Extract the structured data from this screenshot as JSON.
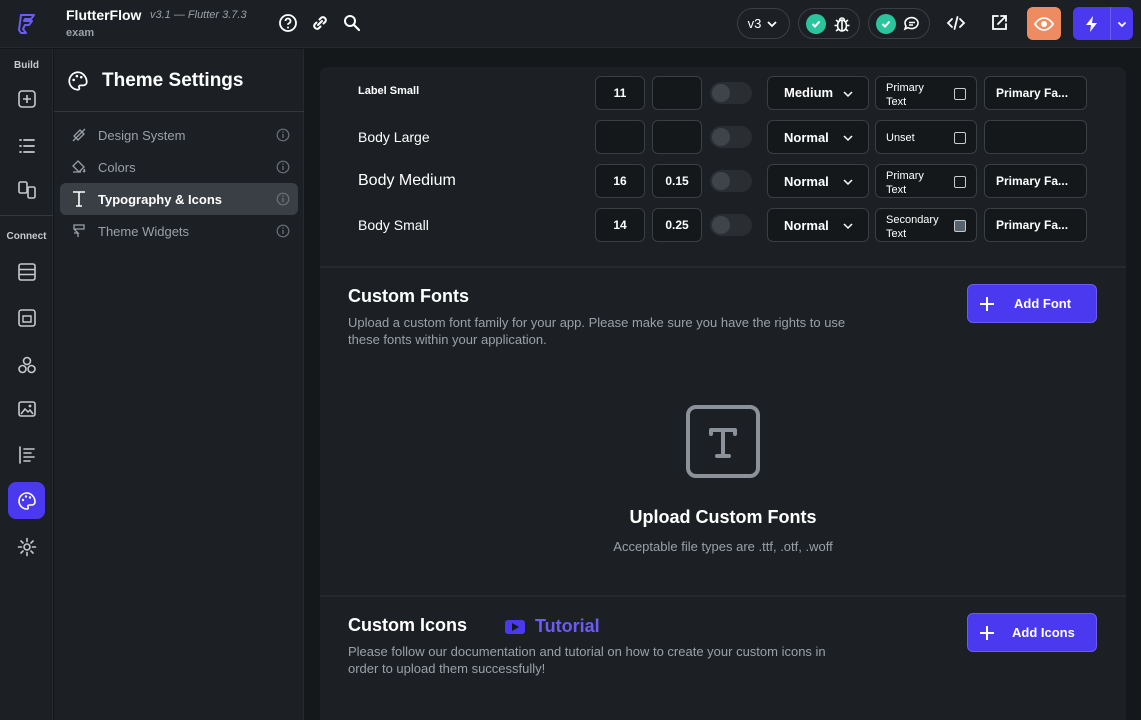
{
  "app": {
    "name": "FlutterFlow",
    "version": "v3.1 — Flutter 3.7.3",
    "project": "exam"
  },
  "topbar": {
    "version_select": "v3"
  },
  "rail": {
    "build_label": "Build",
    "connect_label": "Connect"
  },
  "panel": {
    "title": "Theme Settings",
    "items": [
      {
        "label": "Design System"
      },
      {
        "label": "Colors"
      },
      {
        "label": "Typography & Icons"
      },
      {
        "label": "Theme Widgets"
      }
    ]
  },
  "typography": {
    "rows": [
      {
        "name": "Label Small",
        "size": "11",
        "spacing": "",
        "weight": "Medium",
        "color": "Primary Text",
        "family": "Primary Fa..."
      },
      {
        "name": "Body Large",
        "size": "",
        "spacing": "",
        "weight": "Normal",
        "color": "Unset",
        "family": ""
      },
      {
        "name": "Body Medium",
        "size": "16",
        "spacing": "0.15",
        "weight": "Normal",
        "color": "Primary Text",
        "family": "Primary Fa..."
      },
      {
        "name": "Body Small",
        "size": "14",
        "spacing": "0.25",
        "weight": "Normal",
        "color": "Secondary Text",
        "family": "Primary Fa..."
      }
    ]
  },
  "custom_fonts": {
    "title": "Custom Fonts",
    "description": "Upload a custom font family for your app. Please make sure you have the rights to use these fonts within your application.",
    "add_button": "Add Font",
    "upload_title": "Upload Custom Fonts",
    "upload_subtitle": "Acceptable file types are .ttf, .otf, .woff"
  },
  "custom_icons": {
    "title": "Custom Icons",
    "tutorial_label": "Tutorial",
    "description": "Please follow our documentation and tutorial on how to create your custom icons in order to upload them successfully!",
    "add_button": "Add Icons"
  },
  "colors": {
    "accent": "#4b39ef",
    "check": "#2ac59c",
    "preview": "#ee8b60"
  }
}
